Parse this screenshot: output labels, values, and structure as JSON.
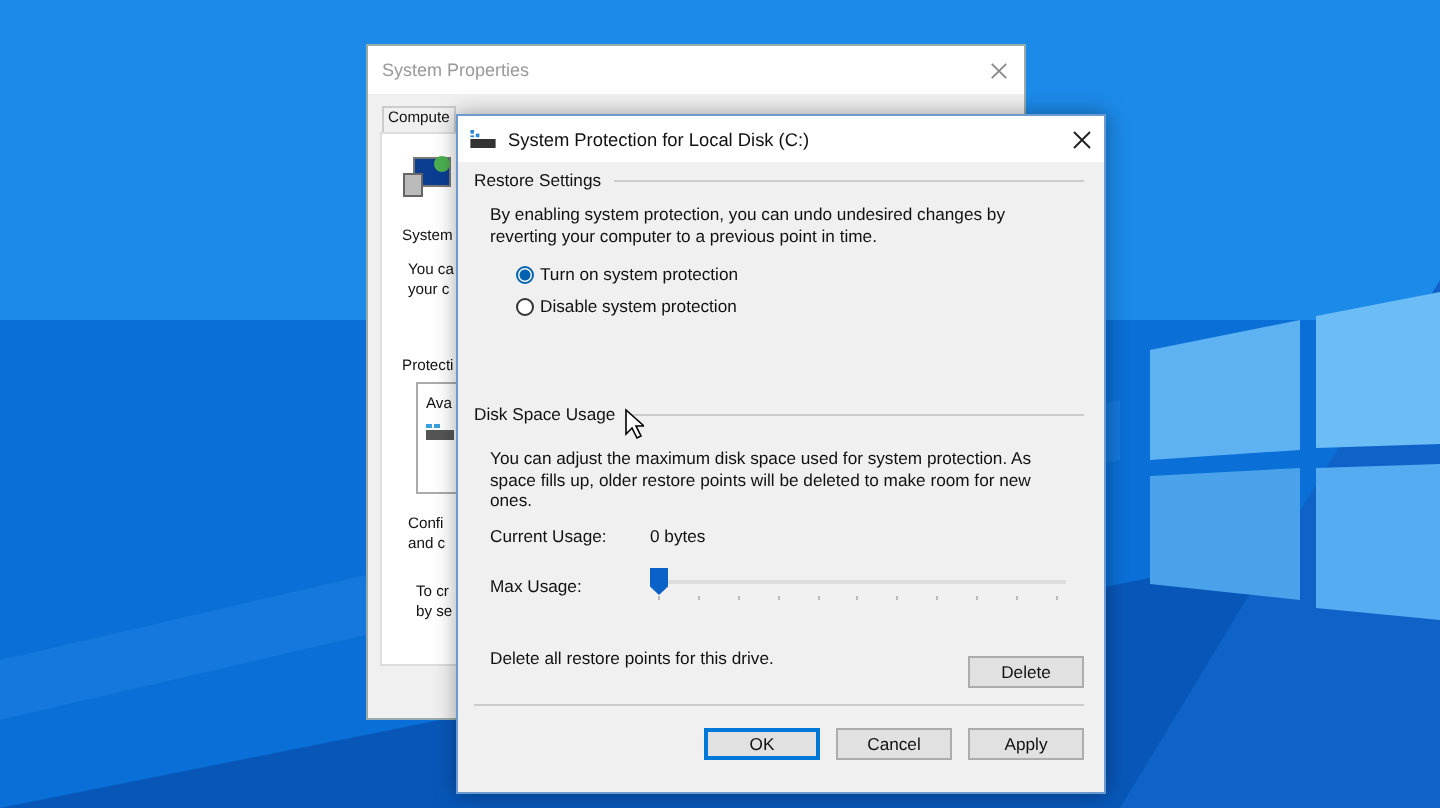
{
  "back_window": {
    "title": "System Properties",
    "tabs": [
      {
        "label": "Compute",
        "selected": false
      }
    ],
    "heading": "System",
    "desc_lines": [
      "You ca",
      "your c"
    ],
    "protection_label": "Protecti",
    "list_header": "Ava",
    "config_lines": [
      "Confi",
      "and c"
    ],
    "create_lines": [
      "To cr",
      "by se"
    ]
  },
  "dialog": {
    "title": "System Protection for Local Disk (C:)",
    "restore": {
      "heading": "Restore Settings",
      "text": "By enabling system protection, you can undo undesired changes by reverting your computer to a previous point in time.",
      "options": [
        {
          "label": "Turn on system protection",
          "selected": true
        },
        {
          "label": "Disable system protection",
          "selected": false
        }
      ]
    },
    "disk": {
      "heading": "Disk Space Usage",
      "text": "You can adjust the maximum disk space used for system protection. As space fills up, older restore points will be deleted to make room for new ones.",
      "current_label": "Current Usage:",
      "current_value": "0 bytes",
      "max_label": "Max Usage:",
      "max_usage": {
        "level": 0
      },
      "delete_text": "Delete all restore points for this drive.",
      "delete_button": "Delete"
    },
    "buttons": [
      {
        "label": "OK",
        "default": true
      },
      {
        "label": "Cancel",
        "default": false
      },
      {
        "label": "Apply",
        "default": false
      }
    ]
  }
}
